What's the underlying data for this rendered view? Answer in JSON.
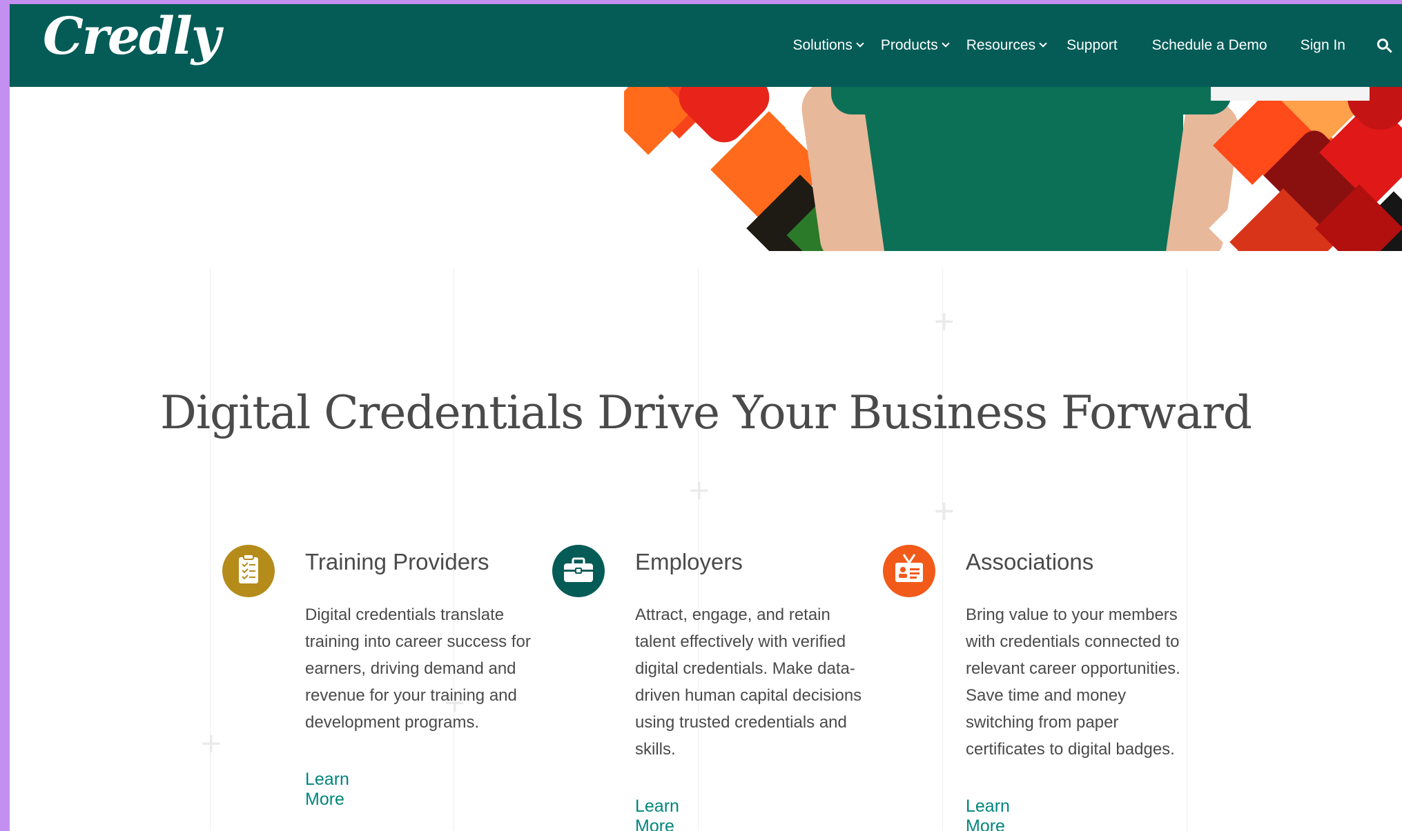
{
  "header": {
    "logo_text": "Credly",
    "nav": [
      {
        "label": "Solutions",
        "dropdown": true
      },
      {
        "label": "Products",
        "dropdown": true
      },
      {
        "label": "Resources",
        "dropdown": true
      },
      {
        "label": "Support",
        "dropdown": false
      },
      {
        "label": "Schedule a Demo",
        "dropdown": false
      },
      {
        "label": "Sign In",
        "dropdown": false
      }
    ],
    "search_icon": "search-icon"
  },
  "main": {
    "title": "Digital Credentials Drive Your Business Forward",
    "columns": [
      {
        "icon": "clipboard-icon",
        "icon_color": "#b58b1a",
        "heading": "Training Providers",
        "body": "Digital credentials translate training into career success for earners, driving demand and revenue for your training and development programs.",
        "link": "Learn More"
      },
      {
        "icon": "briefcase-icon",
        "icon_color": "#055c57",
        "heading": "Employers",
        "body": "Attract, engage, and retain talent effectively with verified digital credentials. Make data-driven human capital decisions using trusted credentials and skills.",
        "link": "Learn More"
      },
      {
        "icon": "id-badge-icon",
        "icon_color": "#f25a1a",
        "heading": "Associations",
        "body": "Bring value to your members with credentials connected to relevant career opportunities. Save time and money switching from paper certificates to digital badges.",
        "link": "Learn More"
      }
    ]
  },
  "colors": {
    "header_bg": "#055c57",
    "accent_link": "#00857c",
    "window_bg": "#c38ff0"
  }
}
